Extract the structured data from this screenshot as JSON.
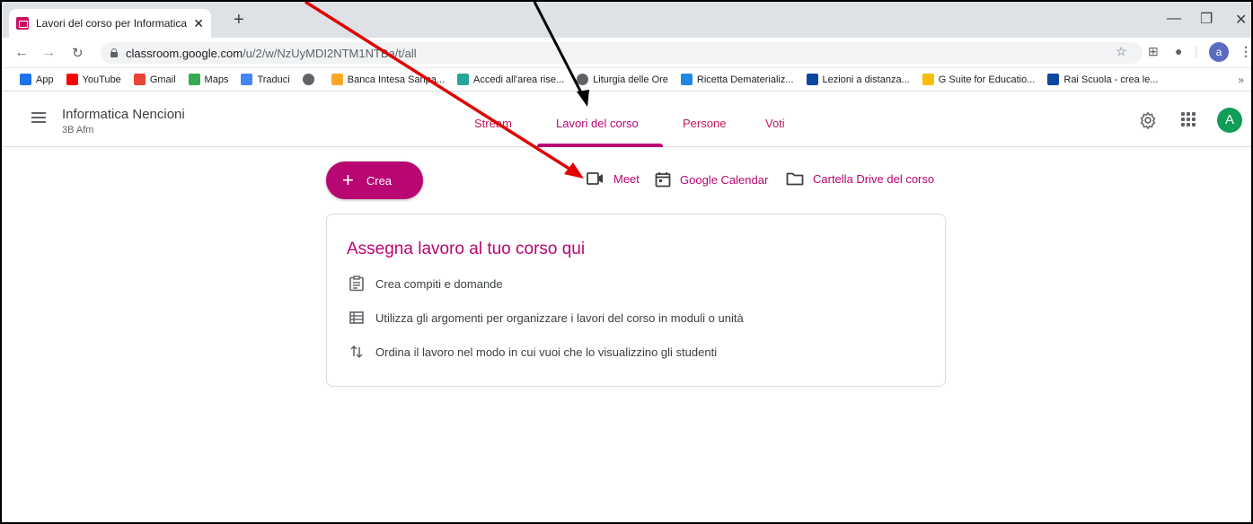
{
  "browser": {
    "tab_title": "Lavori del corso per Informatica N",
    "new_tab_symbol": "+",
    "address": {
      "host": "classroom.google.com",
      "path": "/u/2/w/NzUyMDI2NTM1NTBa/t/all"
    },
    "profile_initial": "a",
    "bookmarks": [
      {
        "label": "App",
        "icon": "apps-grid-icon",
        "color": "#1a73e8"
      },
      {
        "label": "YouTube",
        "icon": "youtube-icon",
        "color": "#ff0000"
      },
      {
        "label": "Gmail",
        "icon": "gmail-icon",
        "color": "#ea4335"
      },
      {
        "label": "Maps",
        "icon": "maps-pin-icon",
        "color": "#34a853"
      },
      {
        "label": "Traduci",
        "icon": "translate-icon",
        "color": "#4285f4"
      },
      {
        "label": "",
        "icon": "globe-icon",
        "color": "#5f6368"
      },
      {
        "label": "Banca Intesa Sanpa...",
        "icon": "bank-icon",
        "color": "#f9a825"
      },
      {
        "label": "Accedi all'area rise...",
        "icon": "puzzle-icon",
        "color": "#26a69a"
      },
      {
        "label": "Liturgia delle Ore",
        "icon": "globe-icon",
        "color": "#5f6368"
      },
      {
        "label": "Ricetta Dematerializ...",
        "icon": "ricetta-icon",
        "color": "#1e88e5"
      },
      {
        "label": "Lezioni a distanza...",
        "icon": "c2-icon",
        "color": "#0d47a1"
      },
      {
        "label": "G Suite for Educatio...",
        "icon": "gsuite-icon",
        "color": "#fbbc04"
      },
      {
        "label": "Rai Scuola - crea le...",
        "icon": "rai-icon",
        "color": "#0d47a1"
      }
    ],
    "bookmarks_more": "»"
  },
  "classroom": {
    "course_name": "Informatica Nencioni",
    "course_section": "3B Afm",
    "tabs": [
      {
        "label": "Stream"
      },
      {
        "label": "Lavori del corso"
      },
      {
        "label": "Persone"
      },
      {
        "label": "Voti"
      }
    ],
    "avatar_initial": "A",
    "accent": "#b80672"
  },
  "main": {
    "create_label": "Crea",
    "tools": [
      {
        "label": "Meet",
        "icon": "video-camera-icon"
      },
      {
        "label": "Google Calendar",
        "icon": "calendar-icon"
      },
      {
        "label": "Cartella Drive del corso",
        "icon": "folder-icon"
      }
    ],
    "card": {
      "title": "Assegna lavoro al tuo corso qui",
      "rows": [
        {
          "text": "Crea compiti e domande",
          "icon": "assignment-icon"
        },
        {
          "text": "Utilizza gli argomenti per organizzare i lavori del corso in moduli o unità",
          "icon": "topic-list-icon"
        },
        {
          "text": "Ordina il lavoro nel modo in cui vuoi che lo visualizzino gli studenti",
          "icon": "reorder-arrows-icon"
        }
      ]
    }
  },
  "annotations": {
    "red_arrow_color": "#e00000",
    "black_arrow_color": "#000000"
  }
}
